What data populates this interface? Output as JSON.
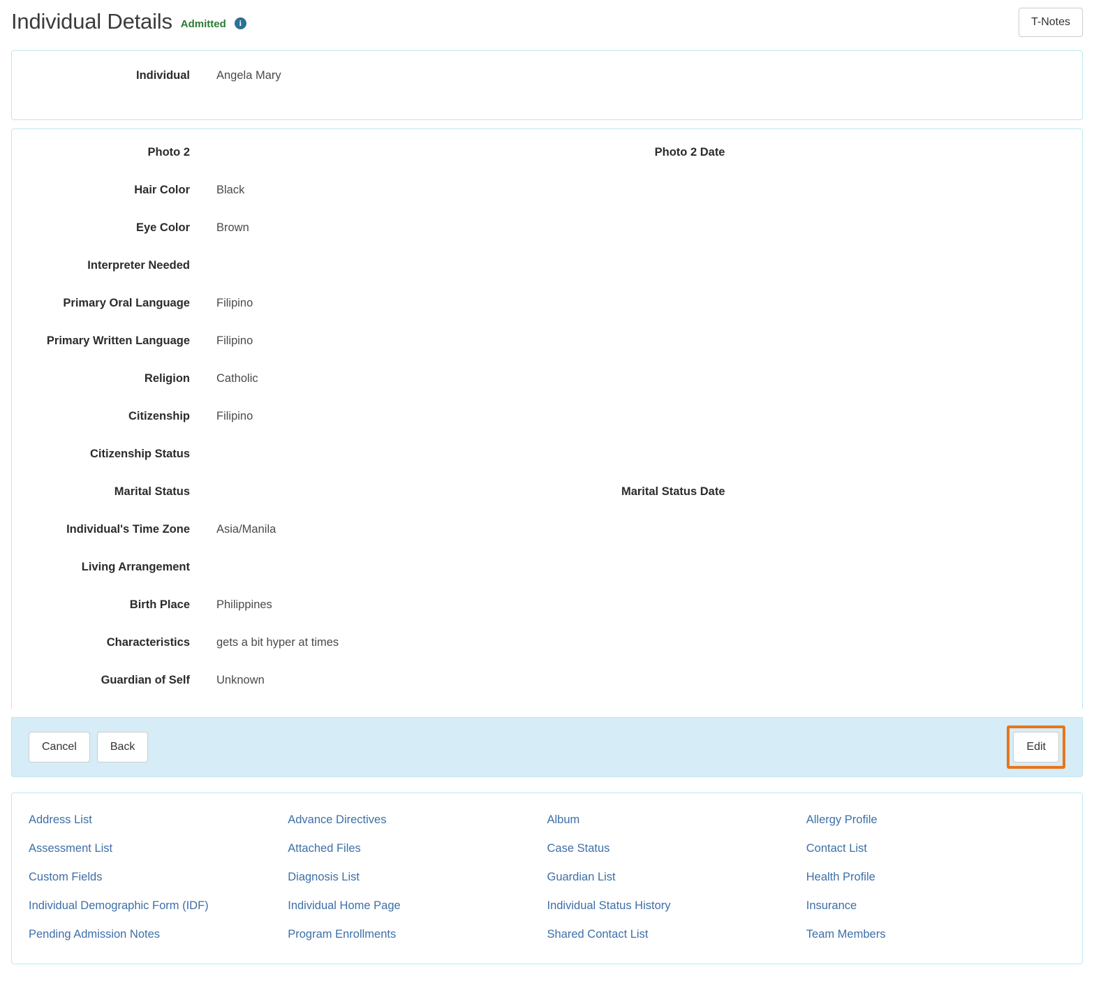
{
  "header": {
    "title": "Individual Details",
    "status": "Admitted",
    "info_icon": "info-circle-icon",
    "tnotes_label": "T-Notes"
  },
  "summary": {
    "label": "Individual",
    "value": "Angela Mary"
  },
  "details": {
    "rows": [
      {
        "label": "Photo 2",
        "value": "",
        "label2": "Photo 2 Date",
        "value2": ""
      },
      {
        "label": "Hair Color",
        "value": "Black",
        "label2": "",
        "value2": ""
      },
      {
        "label": "Eye Color",
        "value": "Brown",
        "label2": "",
        "value2": ""
      },
      {
        "label": "Interpreter Needed",
        "value": "",
        "label2": "",
        "value2": ""
      },
      {
        "label": "Primary Oral Language",
        "value": "Filipino",
        "label2": "",
        "value2": ""
      },
      {
        "label": "Primary Written Language",
        "value": "Filipino",
        "label2": "",
        "value2": ""
      },
      {
        "label": "Religion",
        "value": "Catholic",
        "label2": "",
        "value2": ""
      },
      {
        "label": "Citizenship",
        "value": "Filipino",
        "label2": "",
        "value2": ""
      },
      {
        "label": "Citizenship Status",
        "value": "",
        "label2": "",
        "value2": ""
      },
      {
        "label": "Marital Status",
        "value": "",
        "label2": "Marital Status Date",
        "value2": ""
      },
      {
        "label": "Individual's Time Zone",
        "value": "Asia/Manila",
        "label2": "",
        "value2": ""
      },
      {
        "label": "Living Arrangement",
        "value": "",
        "label2": "",
        "value2": ""
      },
      {
        "label": "Birth Place",
        "value": "Philippines",
        "label2": "",
        "value2": ""
      },
      {
        "label": "Characteristics",
        "value": "gets a bit hyper at times",
        "label2": "",
        "value2": ""
      },
      {
        "label": "Guardian of Self",
        "value": "Unknown",
        "label2": "",
        "value2": ""
      }
    ]
  },
  "actions": {
    "cancel_label": "Cancel",
    "back_label": "Back",
    "edit_label": "Edit",
    "highlight_color": "#e8751a"
  },
  "related_links": [
    "Address List",
    "Advance Directives",
    "Album",
    "Allergy Profile",
    "Assessment List",
    "Attached Files",
    "Case Status",
    "Contact List",
    "Custom Fields",
    "Diagnosis List",
    "Guardian List",
    "Health Profile",
    "Individual Demographic Form (IDF)",
    "Individual Home Page",
    "Individual Status History",
    "Insurance",
    "Pending Admission Notes",
    "Program Enrollments",
    "Shared Contact List",
    "Team Members"
  ],
  "colors": {
    "card_border": "#bce8f1",
    "action_bar_bg": "#d6ecf7",
    "link": "#3d6fa8",
    "status_green": "#2a7a34",
    "info_icon": "#2b7193"
  }
}
